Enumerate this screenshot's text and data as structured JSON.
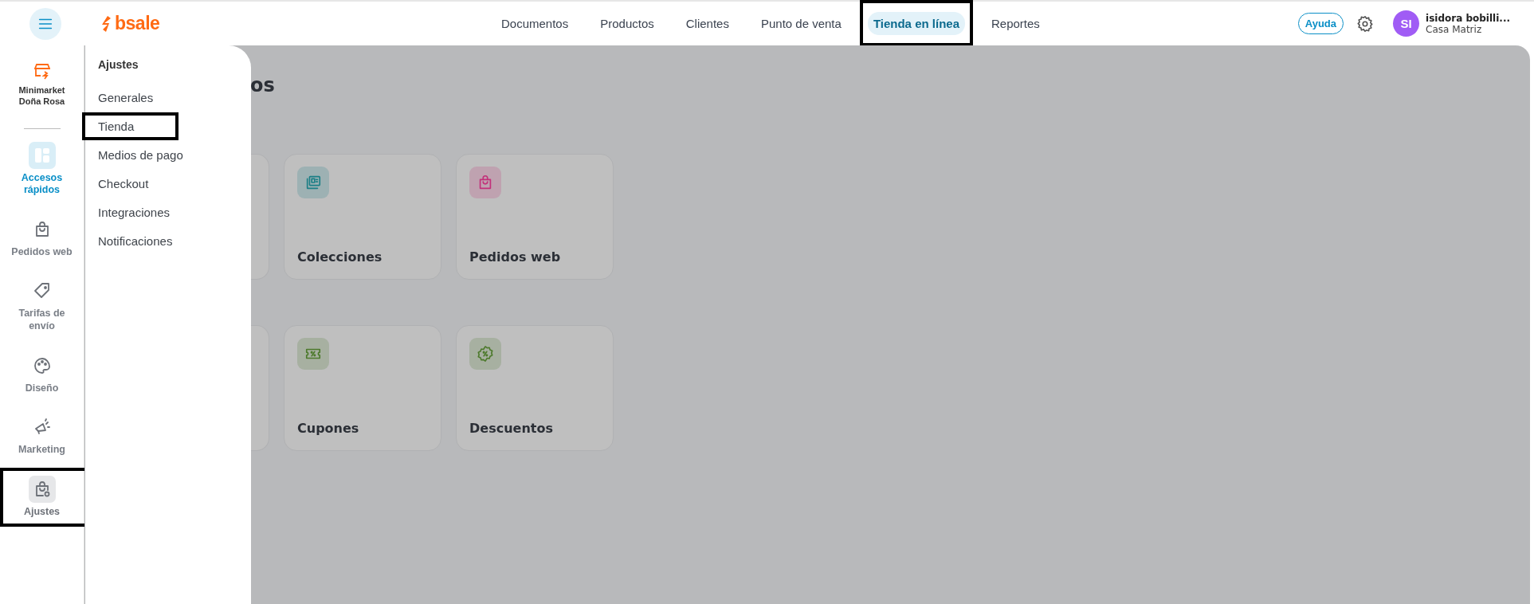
{
  "top_bar": {
    "logo": "bsale",
    "nav": [
      {
        "label": "Documentos",
        "selected": false,
        "highlighted": false
      },
      {
        "label": "Productos",
        "selected": false,
        "highlighted": false
      },
      {
        "label": "Clientes",
        "selected": false,
        "highlighted": false
      },
      {
        "label": "Punto de venta",
        "selected": false,
        "highlighted": false
      },
      {
        "label": "Tienda en línea",
        "selected": true,
        "highlighted": true
      },
      {
        "label": "Reportes",
        "selected": false,
        "highlighted": false
      }
    ],
    "help_button": "Ayuda",
    "user": {
      "initials": "SI",
      "name": "isidora bobilli...",
      "branch": "Casa Matriz"
    }
  },
  "sidebar": {
    "store_name": "Minimarket Doña Rosa",
    "items": [
      {
        "label": "Accesos rápidos",
        "kind": "grid",
        "selected": true,
        "open": false,
        "highlighted": false
      },
      {
        "label": "Pedidos web",
        "kind": "bag",
        "selected": false,
        "open": false,
        "highlighted": false
      },
      {
        "label": "Tarifas de envío",
        "kind": "tag",
        "selected": false,
        "open": false,
        "highlighted": false
      },
      {
        "label": "Diseño",
        "kind": "palette",
        "selected": false,
        "open": false,
        "highlighted": false
      },
      {
        "label": "Marketing",
        "kind": "megaphone",
        "selected": false,
        "open": false,
        "highlighted": false
      },
      {
        "label": "Ajustes",
        "kind": "bag-gear",
        "selected": false,
        "open": true,
        "highlighted": true
      }
    ]
  },
  "settings_menu": {
    "title": "Ajustes",
    "items": [
      {
        "label": "Generales",
        "highlighted": false
      },
      {
        "label": "Tienda",
        "highlighted": true
      },
      {
        "label": "Medios de pago",
        "highlighted": false
      },
      {
        "label": "Checkout",
        "highlighted": false
      },
      {
        "label": "Integraciones",
        "highlighted": false
      },
      {
        "label": "Notificaciones",
        "highlighted": false
      }
    ]
  },
  "content": {
    "heading": "os",
    "sections": [
      {
        "cut_card": true,
        "cards": [
          {
            "title": "Colecciones",
            "kind": "collection",
            "color": "#1b7f86"
          },
          {
            "title": "Pedidos web",
            "kind": "bag",
            "color": "#c3307a"
          }
        ]
      },
      {
        "cut_card": true,
        "cards": [
          {
            "title": "Cupones",
            "kind": "ticket",
            "color": "#4d7a2c"
          },
          {
            "title": "Descuentos",
            "kind": "badge",
            "color": "#4d7a2c"
          }
        ]
      }
    ]
  }
}
